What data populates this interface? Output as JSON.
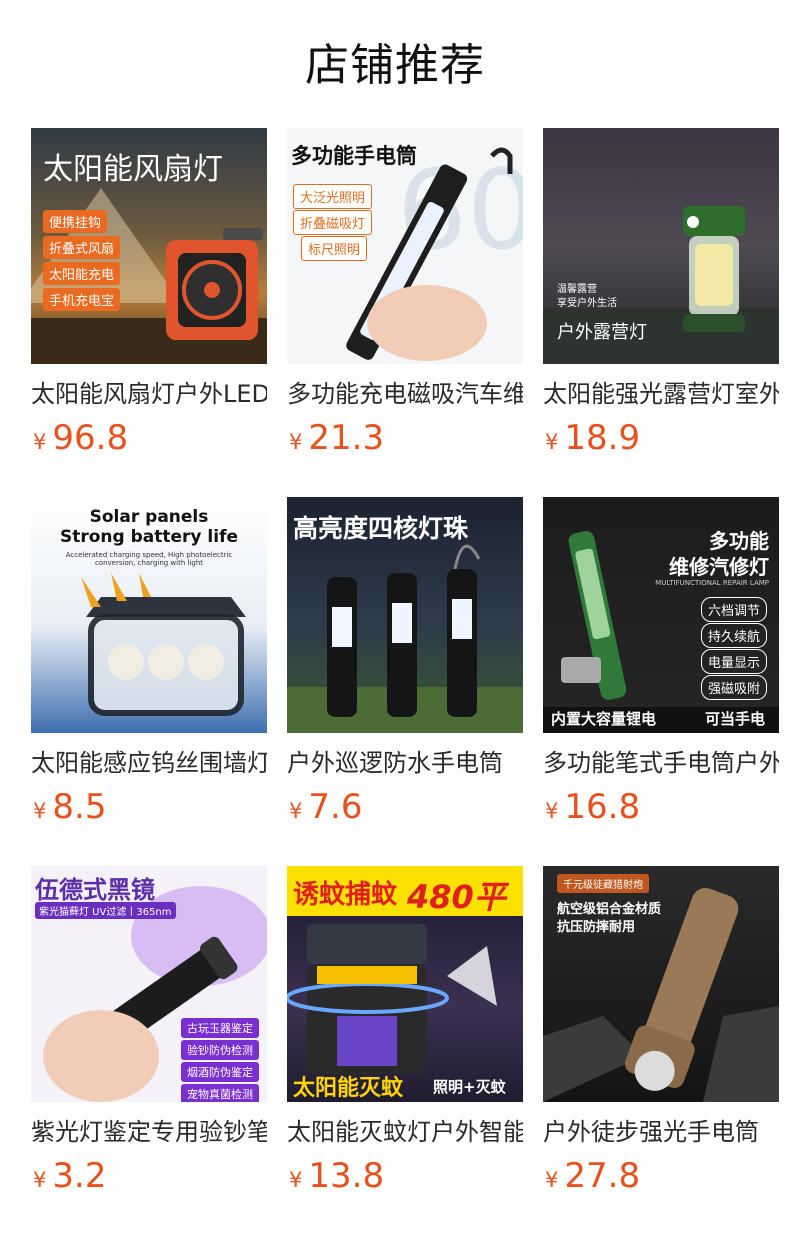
{
  "page": {
    "title": "店铺推荐"
  },
  "products": [
    {
      "name": "太阳能风扇灯户外LED",
      "currency": "¥",
      "price": "96.8",
      "image": {
        "title": "太阳能风扇灯",
        "tags": [
          "便携挂钩",
          "折叠式风扇",
          "太阳能充电",
          "手机充电宝"
        ]
      }
    },
    {
      "name": "多功能充电磁吸汽车维修灯",
      "currency": "¥",
      "price": "21.3",
      "image": {
        "title": "多功能手电筒",
        "tags": [
          "大泛光照明",
          "折叠磁吸灯",
          "标尺照明"
        ]
      }
    },
    {
      "name": "太阳能强光露营灯室外",
      "currency": "¥",
      "price": "18.9",
      "image": {
        "caption_small": "温馨露营",
        "caption_small2": "享受户外生活",
        "caption": "户外露营灯"
      }
    },
    {
      "name": "太阳能感应钨丝围墙灯",
      "currency": "¥",
      "price": "8.5",
      "image": {
        "title": "Solar panels",
        "subtitle": "Strong battery life",
        "small": "Accelerated charging speed, High photoelectric conversion, charging with light"
      }
    },
    {
      "name": "户外巡逻防水手电筒",
      "currency": "¥",
      "price": "7.6",
      "image": {
        "title": "高亮度四核灯珠"
      }
    },
    {
      "name": "多功能笔式手电筒户外",
      "currency": "¥",
      "price": "16.8",
      "image": {
        "title": "多功能",
        "title2": "维修汽修灯",
        "small": "MULTIFUNCTIONAL REPAIR LAMP",
        "tags": [
          "六档调节",
          "持久续航",
          "电量显示",
          "强磁吸附"
        ],
        "bottom_left": "内置大容量锂电",
        "bottom_right": "可当手电"
      }
    },
    {
      "name": "紫光灯鉴定专用验钞笔",
      "currency": "¥",
      "price": "3.2",
      "image": {
        "title": "伍德式黑镜",
        "subtitle": "紫光猫藓灯 UV过滤丨365nm",
        "tags": [
          "古玩玉器鉴定",
          "验钞防伪检测",
          "烟酒防伪鉴定",
          "宠物真菌检测"
        ]
      }
    },
    {
      "name": "太阳能灭蚊灯户外智能",
      "currency": "¥",
      "price": "13.8",
      "image": {
        "title": "诱蚊捕蚊",
        "title_num": "480平",
        "bottom": "太阳能灭蚊",
        "bottom_right": "照明+灭蚊"
      }
    },
    {
      "name": "户外徒步强光手电筒",
      "currency": "¥",
      "price": "27.8",
      "image": {
        "badge": "千元级徒藏猎射炮",
        "title": "航空级铝合金材质",
        "subtitle": "抗压防摔耐用"
      }
    }
  ],
  "colors": {
    "price": "#e8501c",
    "title": "#111111",
    "text": "#2a2a2a"
  }
}
